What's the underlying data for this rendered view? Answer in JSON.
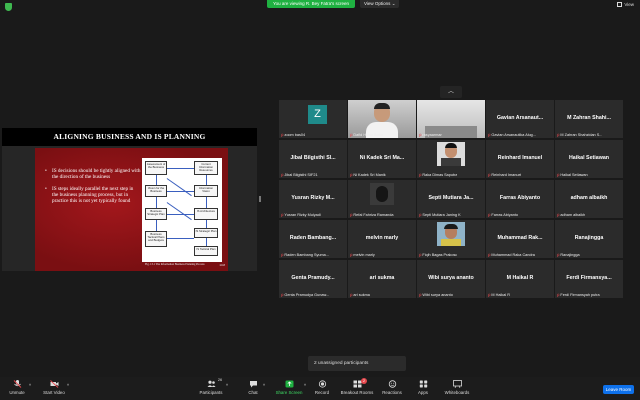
{
  "topbar": {
    "share_banner": "You are viewing R. Bey Fatra's screen",
    "view_options": "View Options",
    "view_options_caret": "⌄",
    "view_button": "View"
  },
  "slide": {
    "title": "ALIGNING BUSINESS AND IS PLANNING",
    "bullets": [
      "IS decisions should be tightly aligned with the direction of the business",
      "IS steps ideally parallel the next step in the business planning process, but in practice this is not yet typically found"
    ],
    "figure_boxes": [
      "Assessment of the Business",
      "Current Information Resources",
      "Vision for the Business",
      "Information Vision",
      "Business Strategic Plan",
      "IS Architecture",
      "Business Tactical Plans and Budgets",
      "IS Strategic Plan",
      "IS Tactical Plan"
    ],
    "caption": "Fig. 13.1 The Information Business Planning Process",
    "page_number": "13-8"
  },
  "gallery": {
    "tiles": [
      {
        "name": "",
        "label": "zoom bas04",
        "avatar": "Z"
      },
      {
        "name": "",
        "label": "Dafid Helmi Bahri",
        "photo": "person"
      },
      {
        "name": "",
        "label": "rasyaarman",
        "photo": "room"
      },
      {
        "name": "Gavian Arsanaut...",
        "label": "Gavian Arsanautika Alug..."
      },
      {
        "name": "M Zahran Shahi...",
        "label": "M Zahran Shahzidan S..."
      },
      {
        "name": "Jibal Bilgisthi Sl...",
        "label": "Jibal Bilgisthi SIF21"
      },
      {
        "name": "Ni Kadek Sri Ma...",
        "label": "Ni Kadek Sri Manik"
      },
      {
        "name": "",
        "label": "Raka Dimas Saputra",
        "photo": "face"
      },
      {
        "name": "Reinhard Imanuel",
        "label": "Reinhard Imanuel"
      },
      {
        "name": "Haikal Setiawan",
        "label": "Haikal Setiawan"
      },
      {
        "name": "Yusran Rizky M...",
        "label": "Yusran Rizky Mulyadi"
      },
      {
        "name": "",
        "label": "Refal Fahriza Ramanda",
        "photo": "dark"
      },
      {
        "name": "Septi Mutiara Ja...",
        "label": "Septi Mutiara Janing K"
      },
      {
        "name": "Farras Abiyanto",
        "label": "Farras Abiyanto"
      },
      {
        "name": "adham albaikh",
        "label": "adham albaikh"
      },
      {
        "name": "Raden Bambang...",
        "label": "Raden Bambang Syuma..."
      },
      {
        "name": "melvin marly",
        "label": "melvin marly"
      },
      {
        "name": "",
        "label": "Fiqih Bagas Prakoso",
        "photo": "face2"
      },
      {
        "name": "Muhammad Rak...",
        "label": "Muhammad Raka Candra"
      },
      {
        "name": "Ranajingga",
        "label": "Ranajingga"
      },
      {
        "name": "Genta Pramudy...",
        "label": "Genta Pramudya Gunaw..."
      },
      {
        "name": "ari sukma",
        "label": "ari sukma"
      },
      {
        "name": "Wibi surya ananto",
        "label": "Wibi surya ananto"
      },
      {
        "name": "M Haikal R",
        "label": "M Haikal R"
      },
      {
        "name": "Ferdi Firmansya...",
        "label": "Ferdi Firmansyah putra"
      }
    ],
    "mic_icon": "ꝑ",
    "scroll_up_icon": "︿"
  },
  "unassigned": "2 unassigned participants",
  "toolbar": {
    "unmute": "Unmute",
    "start_video": "Start Video",
    "participants": "Participants",
    "participants_count": "26",
    "chat": "Chat",
    "share_screen": "Share Screen",
    "record": "Record",
    "breakout_rooms": "Breakout Rooms",
    "breakout_badge": "2",
    "reactions": "Reactions",
    "apps": "Apps",
    "whiteboards": "Whiteboards",
    "leave_room": "Leave Room",
    "caret": "^"
  },
  "colors": {
    "share_green": "#1fb141",
    "leave_blue": "#0e71eb",
    "slide_red": "#7a0f12",
    "tile_bg": "#2b2b2b",
    "mic_muted": "#e5484d"
  }
}
